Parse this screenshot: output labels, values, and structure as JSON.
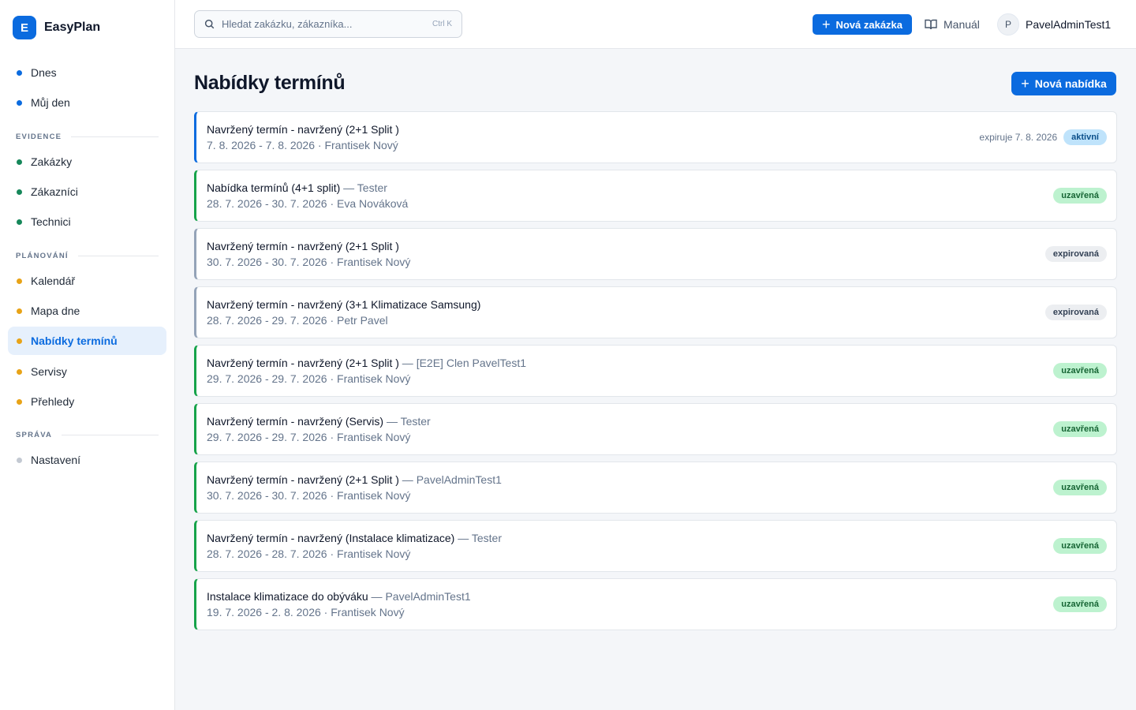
{
  "brand": {
    "logo_letter": "E",
    "name": "EasyPlan"
  },
  "sidebar": {
    "items_top": [
      {
        "label": "Dnes",
        "color": "#0b6bdf"
      },
      {
        "label": "Můj den",
        "color": "#0b6bdf"
      }
    ],
    "sections": [
      {
        "label": "EVIDENCE",
        "items": [
          {
            "label": "Zakázky",
            "color": "#16875a"
          },
          {
            "label": "Zákazníci",
            "color": "#16875a"
          },
          {
            "label": "Technici",
            "color": "#16875a"
          }
        ]
      },
      {
        "label": "PLÁNOVÁNÍ",
        "items": [
          {
            "label": "Kalendář",
            "color": "#e8a317"
          },
          {
            "label": "Mapa dne",
            "color": "#e8a317"
          },
          {
            "label": "Nabídky termínů",
            "color": "#e8a317",
            "active": true
          },
          {
            "label": "Servisy",
            "color": "#e8a317"
          },
          {
            "label": "Přehledy",
            "color": "#e8a317"
          }
        ]
      },
      {
        "label": "SPRÁVA",
        "items": [
          {
            "label": "Nastavení",
            "color": "#c3c9d2"
          }
        ]
      }
    ]
  },
  "topbar": {
    "search_placeholder": "Hledat zakázku, zákazníka...",
    "search_shortcut": "Ctrl K",
    "new_order_label": "Nová zakázka",
    "manual_label": "Manuál",
    "user_initial": "P",
    "user_name": "PavelAdminTest1"
  },
  "page": {
    "title": "Nabídky termínů",
    "new_offer_label": "Nová nabídka"
  },
  "offers": [
    {
      "title": "Navržený termín - navržený (2+1 Split )",
      "author": "",
      "dates": "7. 8. 2026 - 7. 8. 2026",
      "technician": "Frantisek Nový",
      "expires": "expiruje 7. 8. 2026",
      "status": "aktivní",
      "status_key": "aktivni"
    },
    {
      "title": "Nabídka termínů (4+1 split)",
      "author": "Tester",
      "dates": "28. 7. 2026 - 30. 7. 2026",
      "technician": "Eva Nováková",
      "expires": "",
      "status": "uzavřená",
      "status_key": "uzavrena"
    },
    {
      "title": "Navržený termín - navržený (2+1 Split )",
      "author": "",
      "dates": "30. 7. 2026 - 30. 7. 2026",
      "technician": "Frantisek Nový",
      "expires": "",
      "status": "expirovaná",
      "status_key": "expirovana"
    },
    {
      "title": "Navržený termín - navržený (3+1 Klimatizace Samsung)",
      "author": "",
      "dates": "28. 7. 2026 - 29. 7. 2026",
      "technician": "Petr Pavel",
      "expires": "",
      "status": "expirovaná",
      "status_key": "expirovana"
    },
    {
      "title": "Navržený termín - navržený (2+1 Split )",
      "author": "[E2E] Clen PavelTest1",
      "dates": "29. 7. 2026 - 29. 7. 2026",
      "technician": "Frantisek Nový",
      "expires": "",
      "status": "uzavřená",
      "status_key": "uzavrena"
    },
    {
      "title": "Navržený termín - navržený (Servis)",
      "author": "Tester",
      "dates": "29. 7. 2026 - 29. 7. 2026",
      "technician": "Frantisek Nový",
      "expires": "",
      "status": "uzavřená",
      "status_key": "uzavrena"
    },
    {
      "title": "Navržený termín - navržený (2+1 Split )",
      "author": "PavelAdminTest1",
      "dates": "30. 7. 2026 - 30. 7. 2026",
      "technician": "Frantisek Nový",
      "expires": "",
      "status": "uzavřená",
      "status_key": "uzavrena"
    },
    {
      "title": "Navržený termín - navržený (Instalace klimatizace)",
      "author": "Tester",
      "dates": "28. 7. 2026 - 28. 7. 2026",
      "technician": "Frantisek Nový",
      "expires": "",
      "status": "uzavřená",
      "status_key": "uzavrena"
    },
    {
      "title": "Instalace klimatizace do obýváku",
      "author": "PavelAdminTest1",
      "dates": "19. 7. 2026 - 2. 8. 2026",
      "technician": "Frantisek Nový",
      "expires": "",
      "status": "uzavřená",
      "status_key": "uzavrena"
    }
  ]
}
